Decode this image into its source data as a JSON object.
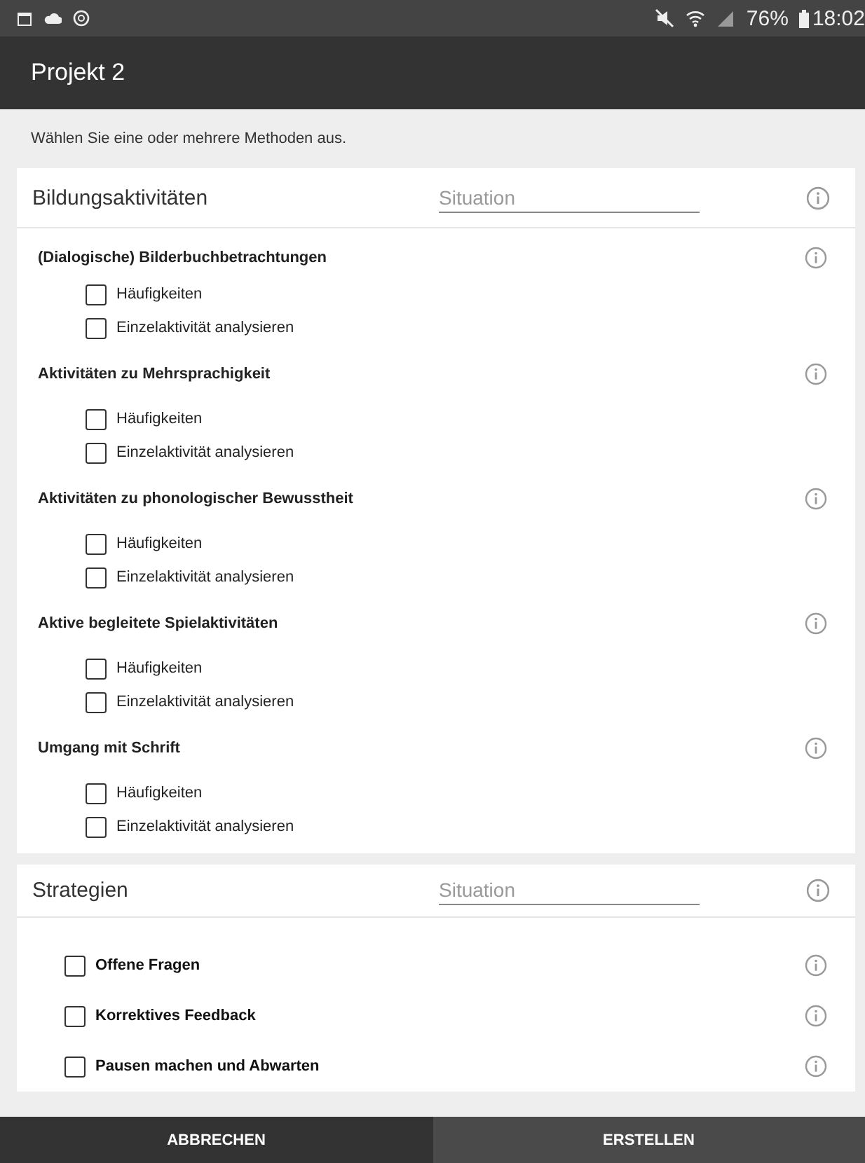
{
  "status_bar": {
    "battery": "76%",
    "time": "18:02"
  },
  "app_bar": {
    "title": "Projekt 2"
  },
  "intro": "Wählen Sie eine oder mehrere Methoden aus.",
  "sections": [
    {
      "title": "Bildungsaktivitäten",
      "field": {
        "placeholder": "Situation"
      },
      "kind": "grouped",
      "groups": [
        {
          "title": "(Dialogische) Bilderbuchbetrachtungen",
          "options": [
            {
              "label": "Häufigkeiten",
              "checked": false
            },
            {
              "label": "Einzelaktivität analysieren",
              "checked": false
            }
          ]
        },
        {
          "title": "Aktivitäten zu Mehrsprachigkeit",
          "options": [
            {
              "label": "Häufigkeiten",
              "checked": false
            },
            {
              "label": "Einzelaktivität analysieren",
              "checked": false
            }
          ]
        },
        {
          "title": "Aktivitäten zu phonologischer Bewusstheit",
          "options": [
            {
              "label": "Häufigkeiten",
              "checked": false
            },
            {
              "label": "Einzelaktivität analysieren",
              "checked": false
            }
          ]
        },
        {
          "title": "Aktive begleitete Spielaktivitäten",
          "options": [
            {
              "label": "Häufigkeiten",
              "checked": false
            },
            {
              "label": "Einzelaktivität analysieren",
              "checked": false
            }
          ]
        },
        {
          "title": "Umgang mit Schrift",
          "options": [
            {
              "label": "Häufigkeiten",
              "checked": false
            },
            {
              "label": "Einzelaktivität analysieren",
              "checked": false
            }
          ]
        }
      ]
    },
    {
      "title": "Strategien",
      "field": {
        "placeholder": "Situation"
      },
      "kind": "flat",
      "items": [
        {
          "label": "Offene Fragen",
          "checked": false
        },
        {
          "label": "Korrektives Feedback",
          "checked": false
        },
        {
          "label": "Pausen machen und Abwarten",
          "checked": false
        }
      ]
    }
  ],
  "buttons": [
    {
      "label": "ABBRECHEN"
    },
    {
      "label": "ERSTELLEN"
    }
  ]
}
